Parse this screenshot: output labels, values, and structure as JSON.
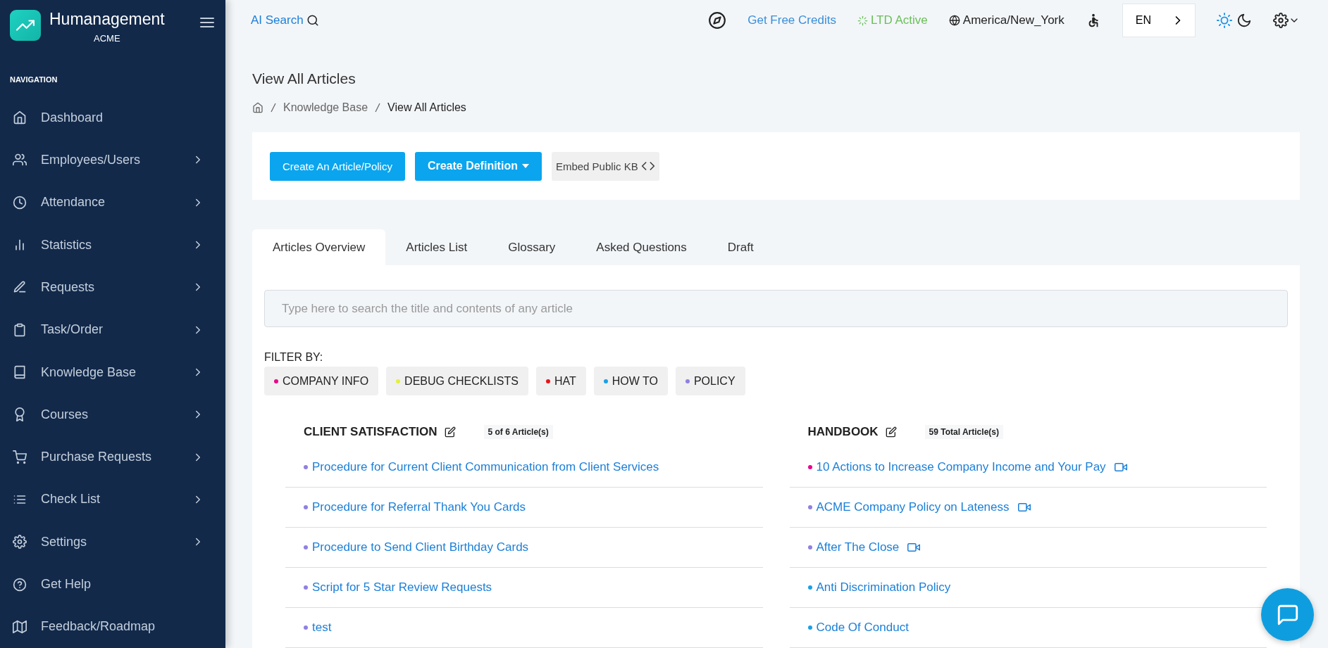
{
  "brand": {
    "name": "Humanagement",
    "company": "ACME"
  },
  "sidebar": {
    "section": "NAVIGATION",
    "items": [
      {
        "label": "Dashboard",
        "expandable": false
      },
      {
        "label": "Employees/Users",
        "expandable": true
      },
      {
        "label": "Attendance",
        "expandable": true
      },
      {
        "label": "Statistics",
        "expandable": true
      },
      {
        "label": "Requests",
        "expandable": true
      },
      {
        "label": "Task/Order",
        "expandable": true
      },
      {
        "label": "Knowledge Base",
        "expandable": true
      },
      {
        "label": "Courses",
        "expandable": true
      },
      {
        "label": "Purchase Requests",
        "expandable": true
      },
      {
        "label": "Check List",
        "expandable": true
      },
      {
        "label": "Settings",
        "expandable": true
      },
      {
        "label": "Get Help",
        "expandable": false
      },
      {
        "label": "Feedback/Roadmap",
        "expandable": false
      }
    ]
  },
  "topbar": {
    "ai_search": "AI Search",
    "credits": "Get Free Credits",
    "ltd": "LTD Active",
    "timezone": "America/New_York",
    "language": "EN",
    "light_theme": true
  },
  "page": {
    "title": "View All Articles",
    "breadcrumb": [
      "Knowledge Base",
      "View All Articles"
    ]
  },
  "actions": {
    "create_article": "Create An Article/Policy",
    "create_definition": "Create Definition",
    "embed": "Embed Public KB"
  },
  "tabs": [
    {
      "label": "Articles Overview",
      "selected": true
    },
    {
      "label": "Articles List",
      "selected": false
    },
    {
      "label": "Glossary",
      "selected": false
    },
    {
      "label": "Asked Questions",
      "selected": false
    },
    {
      "label": "Draft",
      "selected": false
    }
  ],
  "search": {
    "placeholder": "Type here to search the title and contents of any article"
  },
  "filter": {
    "label": "FILTER BY:",
    "tags": [
      {
        "label": "COMPANY INFO",
        "color": "#ec008c"
      },
      {
        "label": "DEBUG CHECKLISTS",
        "color": "#e4f03c"
      },
      {
        "label": "HAT",
        "color": "#e8141c"
      },
      {
        "label": "HOW TO",
        "color": "#1aa0e8"
      },
      {
        "label": "POLICY",
        "color": "#9080e0"
      }
    ]
  },
  "categories": [
    {
      "title": "CLIENT SATISFACTION",
      "count": "5 of 6 Article(s)",
      "articles": [
        {
          "title": "Procedure for Current Client Communication from Client Services",
          "color": "#9080e0",
          "video": false
        },
        {
          "title": "Procedure for Referral Thank You Cards",
          "color": "#9080e0",
          "video": false
        },
        {
          "title": "Procedure to Send Client Birthday Cards",
          "color": "#9080e0",
          "video": false
        },
        {
          "title": "Script for 5 Star Review Requests",
          "color": "#9080e0",
          "video": false
        },
        {
          "title": "test",
          "color": "#9080e0",
          "video": false
        }
      ]
    },
    {
      "title": "HANDBOOK",
      "count": "59 Total Article(s)",
      "articles": [
        {
          "title": "10 Actions to Increase Company Income and Your Pay",
          "color": "#ec008c",
          "video": true
        },
        {
          "title": "ACME Company Policy on Lateness",
          "color": "#9080e0",
          "video": true
        },
        {
          "title": "After The Close",
          "color": "#9080e0",
          "video": true
        },
        {
          "title": "Anti Discrimination Policy",
          "color": "#1aa0e8",
          "video": false
        },
        {
          "title": "Code Of Conduct",
          "color": "#1aa0e8",
          "video": false
        }
      ]
    }
  ]
}
